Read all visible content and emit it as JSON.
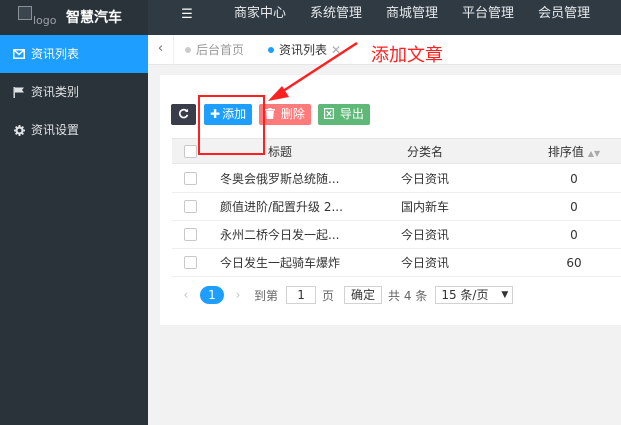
{
  "header": {
    "logo_alt": "logo",
    "brand": "智慧汽车",
    "menu_icon": "hamburger-icon",
    "nav": [
      "商家中心",
      "系统管理",
      "商城管理",
      "平台管理",
      "会员管理"
    ]
  },
  "sidebar": {
    "items": [
      {
        "label": "资讯列表",
        "icon": "mail-icon",
        "active": true
      },
      {
        "label": "资讯类别",
        "icon": "flag-icon",
        "active": false
      },
      {
        "label": "资讯设置",
        "icon": "gear-icon",
        "active": false
      }
    ]
  },
  "tabs": {
    "items": [
      {
        "label": "后台首页",
        "active": false
      },
      {
        "label": "资讯列表",
        "active": true
      }
    ]
  },
  "toolbar": {
    "refresh_icon": "refresh-icon",
    "add_label": "添加",
    "delete_label": "删除",
    "export_label": "导出"
  },
  "table": {
    "headers": {
      "title": "标题",
      "category": "分类名",
      "sort": "排序值"
    },
    "rows": [
      {
        "title": "冬奥会俄罗斯总统随...",
        "category": "今日资讯",
        "sort": "0"
      },
      {
        "title": "颜值进阶/配置升级 2...",
        "category": "国内新车",
        "sort": "0"
      },
      {
        "title": "永州二桥今日发一起...",
        "category": "今日资讯",
        "sort": "0"
      },
      {
        "title": "今日发生一起骑车爆炸",
        "category": "今日资讯",
        "sort": "60"
      }
    ]
  },
  "pager": {
    "current": "1",
    "goto_prefix": "到第",
    "goto_value": "1",
    "goto_suffix": "页",
    "confirm": "确定",
    "total": "共 4 条",
    "page_size": "15 条/页"
  },
  "annotation": {
    "text": "添加文章",
    "color": "#ff2020"
  },
  "colors": {
    "accent": "#1e9fff",
    "danger": "#ff7b7b",
    "success": "#5fb878",
    "dark": "#393d49"
  }
}
